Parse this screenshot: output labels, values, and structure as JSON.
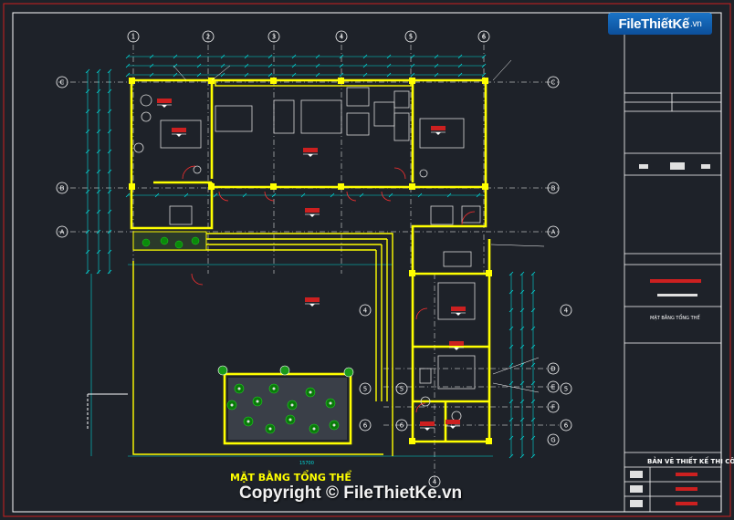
{
  "watermark": {
    "logo_main": "FileThiếtKế",
    "logo_suffix": ".vn",
    "copyright": "Copyright © FileThietKe.vn"
  },
  "drawing": {
    "title": "MẶT BẰNG TỔNG THỂ",
    "overall_width": "15700",
    "grid_cols": [
      "1",
      "2",
      "3",
      "4",
      "5",
      "6"
    ],
    "grid_rows": [
      "C",
      "B",
      "A"
    ],
    "grid_rows_right": [
      "D",
      "E",
      "F",
      "G"
    ],
    "title_block": {
      "label_1": "MẶT BẰNG TỔNG THỂ",
      "label_2": "BẢN VẼ THIẾT KẾ THI CÔNG"
    }
  },
  "colors": {
    "background": "#1e2229",
    "wall": "#ffff00",
    "grid": "#ffffff",
    "dim": "#00d8d8",
    "accent": "#ff2020",
    "furniture": "#d0d0d0",
    "green": "#00c000"
  }
}
